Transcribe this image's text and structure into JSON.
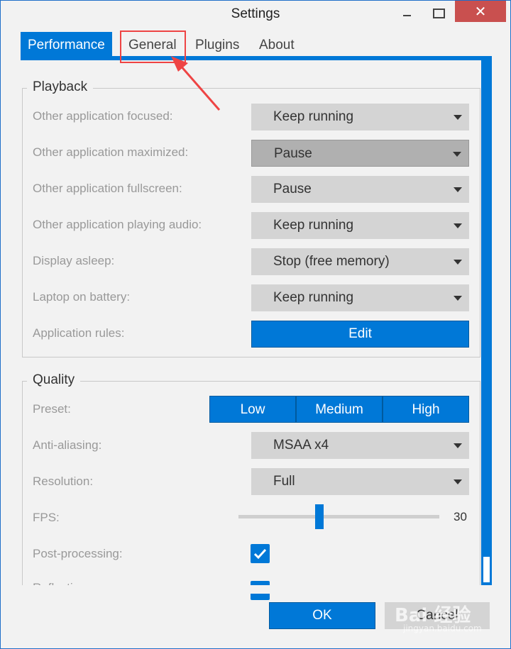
{
  "window": {
    "title": "Settings",
    "close_glyph": "✕"
  },
  "tabs": [
    {
      "label": "Performance",
      "active": true
    },
    {
      "label": "General",
      "active": false
    },
    {
      "label": "Plugins",
      "active": false
    },
    {
      "label": "About",
      "active": false
    }
  ],
  "playback": {
    "title": "Playback",
    "rows": [
      {
        "label": "Other application focused:",
        "value": "Keep running"
      },
      {
        "label": "Other application maximized:",
        "value": "Pause"
      },
      {
        "label": "Other application fullscreen:",
        "value": "Pause"
      },
      {
        "label": "Other application playing audio:",
        "value": "Keep running"
      },
      {
        "label": "Display asleep:",
        "value": "Stop (free memory)"
      },
      {
        "label": "Laptop on battery:",
        "value": "Keep running"
      }
    ],
    "rules_label": "Application rules:",
    "edit_label": "Edit"
  },
  "quality": {
    "title": "Quality",
    "preset_label": "Preset:",
    "presets": [
      "Low",
      "Medium",
      "High"
    ],
    "antialiasing_label": "Anti-aliasing:",
    "antialiasing_value": "MSAA x4",
    "resolution_label": "Resolution:",
    "resolution_value": "Full",
    "fps_label": "FPS:",
    "fps_value": "30",
    "postprocessing_label": "Post-processing:",
    "postprocessing_checked": true,
    "partial_label": "Reflections"
  },
  "footer": {
    "ok_label": "OK",
    "cancel_label": "Cancel",
    "watermark": "Bai 经验",
    "watermark_sub": "jingyan.baidu.com"
  },
  "colors": {
    "accent": "#0078d7",
    "close": "#c9504f",
    "highlight": "#e44444"
  }
}
